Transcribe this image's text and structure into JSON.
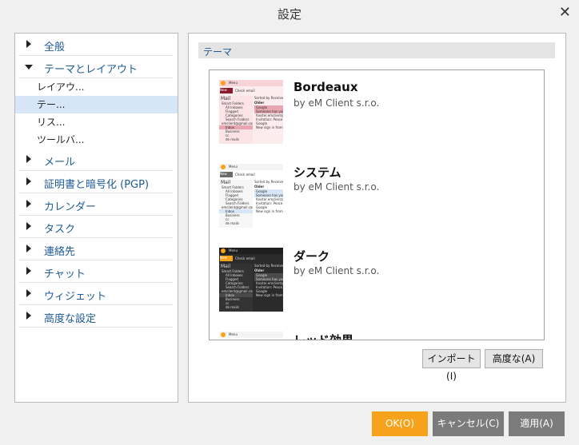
{
  "window": {
    "title": "設定",
    "close_glyph": "✕"
  },
  "nav": {
    "items": [
      {
        "label": "全般",
        "expanded": false
      },
      {
        "label": "テーマとレイアウト",
        "expanded": true,
        "children": [
          "レイアウ...",
          "テー...",
          "リス...",
          "ツールバ..."
        ]
      },
      {
        "label": "メール",
        "expanded": false
      },
      {
        "label": "証明書と暗号化 (PGP)",
        "expanded": false
      },
      {
        "label": "カレンダー",
        "expanded": false
      },
      {
        "label": "タスク",
        "expanded": false
      },
      {
        "label": "連絡先",
        "expanded": false
      },
      {
        "label": "チャット",
        "expanded": false
      },
      {
        "label": "ウィジェット",
        "expanded": false
      },
      {
        "label": "高度な設定",
        "expanded": false
      }
    ],
    "selected_child": "テー..."
  },
  "section": {
    "title": "テーマ"
  },
  "themes": [
    {
      "name": "Bordeaux",
      "author": "by eM Client s.r.o."
    },
    {
      "name": "システム",
      "author": "by eM Client s.r.o."
    },
    {
      "name": "ダーク",
      "author": "by eM Client s.r.o."
    },
    {
      "name": "レッド効果",
      "author": ""
    }
  ],
  "thumbnail_text": {
    "menu": "Menu",
    "new": "New",
    "check": "Check email",
    "mail": "Mail",
    "sorted": "Sorted by Received",
    "older": "Older",
    "folders": [
      "Smart Folders",
      "All Inboxes",
      "Flagged",
      "Categories",
      "Search Folders",
      "emclient@gmail.com",
      "Inbox",
      "Business",
      "cc",
      "de mails"
    ],
    "messages": [
      "Google",
      "Someone has your p...",
      "foxster.emclient@...",
      "Invitation: Peace...",
      "Google",
      "New sign in from Ch..."
    ]
  },
  "buttons": {
    "import": "インポート(I)",
    "advanced": "高度な(A)",
    "ok": "OK(O)",
    "cancel": "キャンセル(C)",
    "apply": "適用(A)"
  },
  "colors": {
    "accent_ok": "#f7a21b",
    "gray_button": "#7b7b7b",
    "bordeaux": "#8b1a2b",
    "system": "#f3f3f3",
    "dark": "#2b2b2b",
    "thumb_orange": "#f7a21b"
  }
}
